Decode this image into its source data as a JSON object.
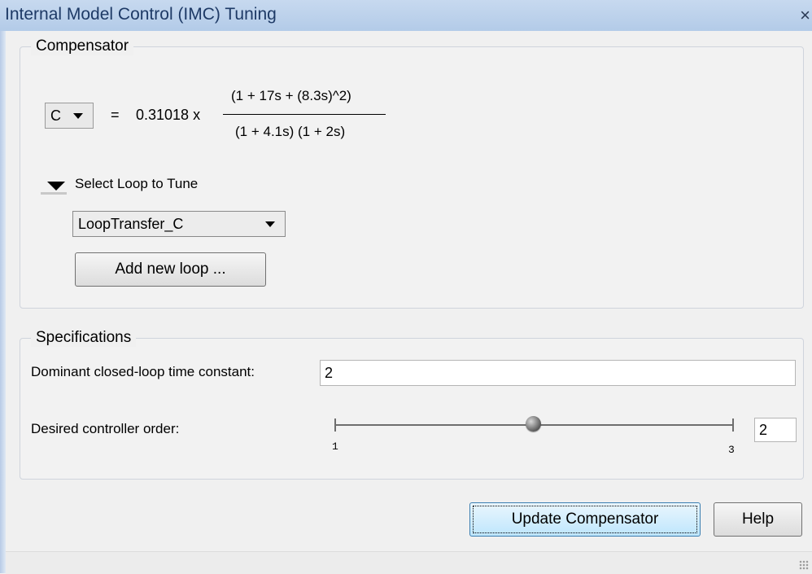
{
  "window": {
    "title": "Internal Model Control (IMC) Tuning",
    "close_symbol": "×"
  },
  "compensator": {
    "legend": "Compensator",
    "selected": "C",
    "equals": "=",
    "gain": "0.31018 x",
    "numerator": "(1 + 17s + (8.3s)^2)",
    "denominator": "(1 + 4.1s) (1 + 2s)",
    "loop_section_label": "Select Loop to Tune",
    "loop_selected": "LoopTransfer_C",
    "add_loop_label": "Add new loop ..."
  },
  "specifications": {
    "legend": "Specifications",
    "time_constant_label": "Dominant closed-loop time constant:",
    "time_constant_value": "2",
    "order_label": "Desired controller order:",
    "order_min": "1",
    "order_max": "3",
    "order_value": "2",
    "order_level_fraction": 0.5
  },
  "footer": {
    "update_label": "Update Compensator",
    "help_label": "Help"
  }
}
